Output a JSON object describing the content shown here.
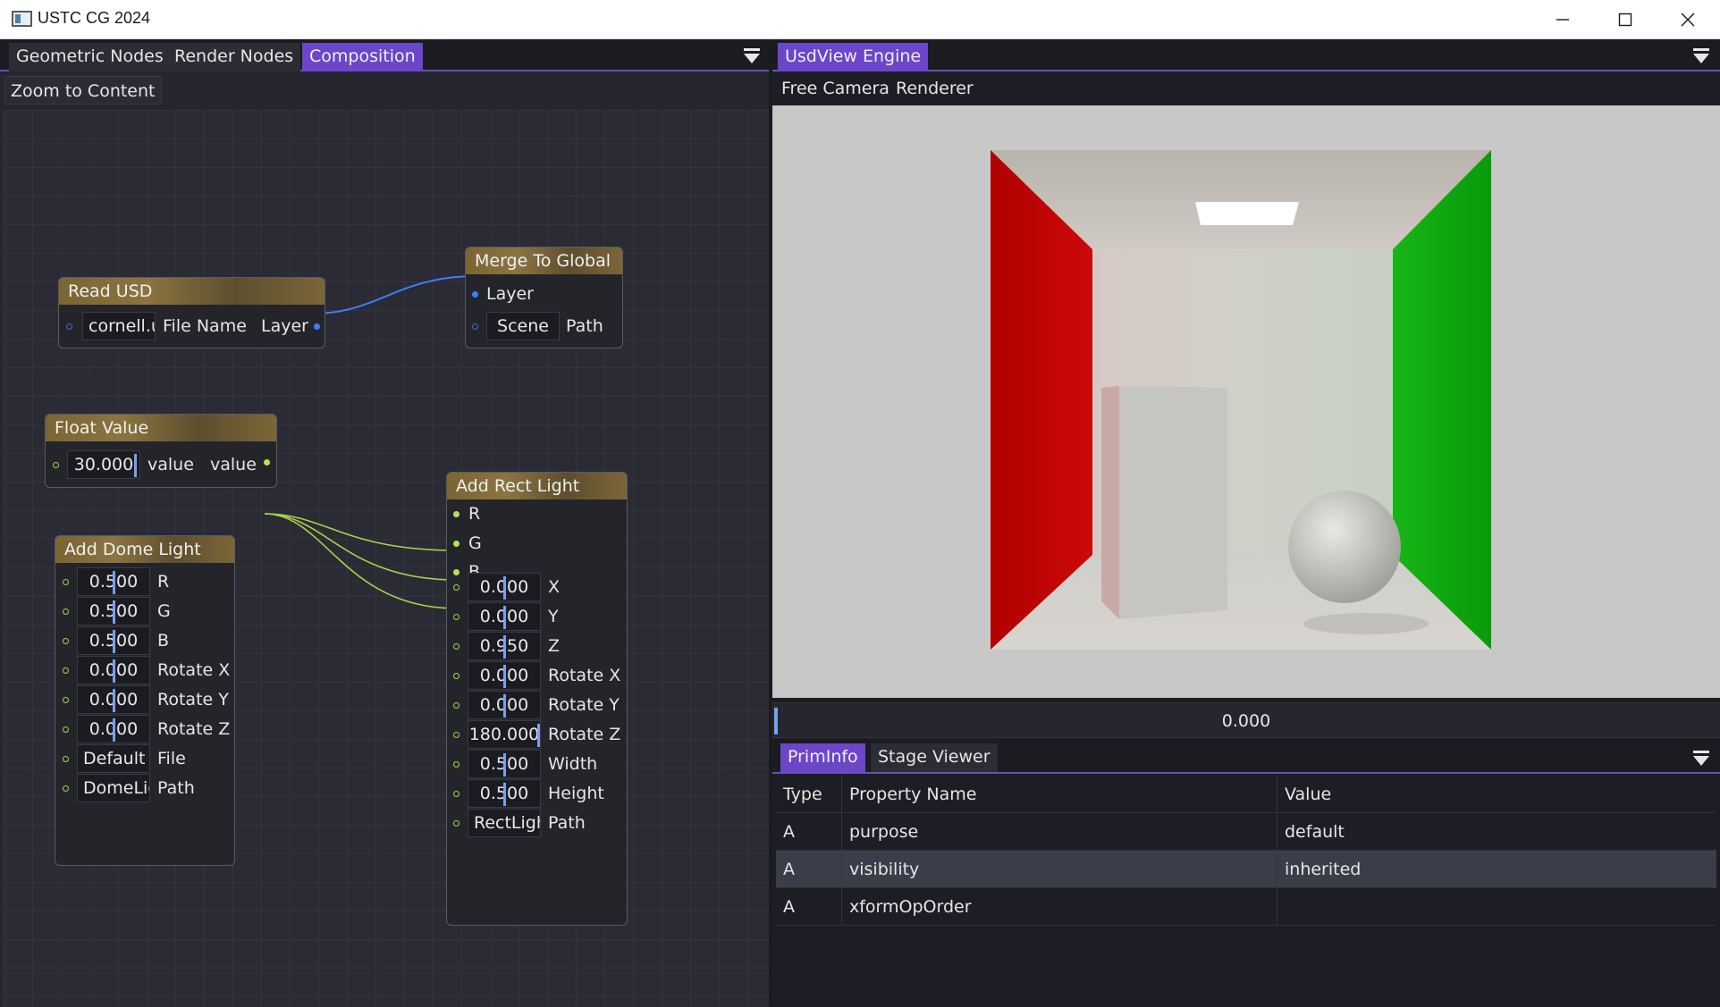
{
  "window": {
    "title": "USTC CG 2024"
  },
  "left_tabs": [
    "Geometric Nodes",
    "Render Nodes",
    "Composition"
  ],
  "toolbar": {
    "zoom_label": "Zoom to Content"
  },
  "nodes": {
    "read_usd": {
      "title": "Read USD",
      "file_value": "cornell.usdc",
      "file_label": "File Name",
      "out_label": "Layer"
    },
    "merge": {
      "title": "Merge To Global",
      "in_label": "Layer",
      "path_value": "Scene",
      "path_label": "Path"
    },
    "float_value": {
      "title": "Float Value",
      "value": "30.000",
      "in_label": "value",
      "out_label": "value"
    },
    "dome": {
      "title": "Add Dome Light",
      "rows": [
        {
          "value": "0.500",
          "label": "R"
        },
        {
          "value": "0.500",
          "label": "G"
        },
        {
          "value": "0.500",
          "label": "B"
        },
        {
          "value": "0.000",
          "label": "Rotate X"
        },
        {
          "value": "0.000",
          "label": "Rotate Y"
        },
        {
          "value": "0.000",
          "label": "Rotate Z"
        },
        {
          "value": "Default",
          "label": "File"
        },
        {
          "value": "DomeLight",
          "label": "Path"
        }
      ]
    },
    "rect": {
      "title": "Add Rect Light",
      "inputs": [
        "R",
        "G",
        "B"
      ],
      "rows": [
        {
          "value": "0.000",
          "label": "X"
        },
        {
          "value": "0.000",
          "label": "Y"
        },
        {
          "value": "0.950",
          "label": "Z"
        },
        {
          "value": "0.000",
          "label": "Rotate X"
        },
        {
          "value": "0.000",
          "label": "Rotate Y"
        },
        {
          "value": "180.000",
          "label": "Rotate Z"
        },
        {
          "value": "0.500",
          "label": "Width"
        },
        {
          "value": "0.500",
          "label": "Height"
        },
        {
          "value": "RectLight",
          "label": "Path"
        }
      ]
    }
  },
  "right_tab": "UsdView Engine",
  "viewport_menu": {
    "camera": "Free Camera",
    "renderer": "Renderer"
  },
  "timeline": {
    "value": "0.000"
  },
  "prim_tabs": [
    "PrimInfo",
    "Stage Viewer"
  ],
  "prim_table": {
    "headers": [
      "Type",
      "Property Name",
      "Value"
    ],
    "rows": [
      {
        "type": "A",
        "name": "purpose",
        "value": "default"
      },
      {
        "type": "A",
        "name": "visibility",
        "value": "inherited"
      },
      {
        "type": "A",
        "name": "xformOpOrder",
        "value": ""
      }
    ]
  },
  "colors": {
    "accent": "#6b46c8",
    "node_header": "#7a6533",
    "wire_layer": "#3f7dff",
    "wire_float": "#a7d34a"
  }
}
